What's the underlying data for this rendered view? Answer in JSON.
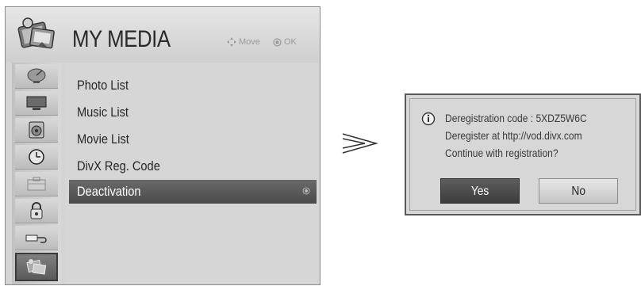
{
  "menu": {
    "title": "MY MEDIA",
    "hint_move": "Move",
    "hint_ok": "OK",
    "items": [
      {
        "label": "Photo List"
      },
      {
        "label": "Music List"
      },
      {
        "label": "Movie List"
      },
      {
        "label": "DivX Reg. Code"
      },
      {
        "label": "Deactivation",
        "selected": true
      }
    ],
    "sidebar_icons": [
      "satellite-dish-icon",
      "monitor-icon",
      "speaker-icon",
      "clock-icon",
      "briefcase-icon",
      "padlock-icon",
      "usb-cable-icon",
      "my-media-icon"
    ],
    "active_sidebar_icon": "my-media-icon"
  },
  "dialog": {
    "line1": "Deregistration code : 5XDZ5W6C",
    "line2": "Deregister at http://vod.divx.com",
    "line3": "Continue with registration?",
    "yes_label": "Yes",
    "no_label": "No",
    "focused_button": "Yes"
  },
  "colors": {
    "selected_bg": "#555555",
    "menu_bg": "#d6d6d6",
    "dialog_bg": "#d7d7d7"
  }
}
